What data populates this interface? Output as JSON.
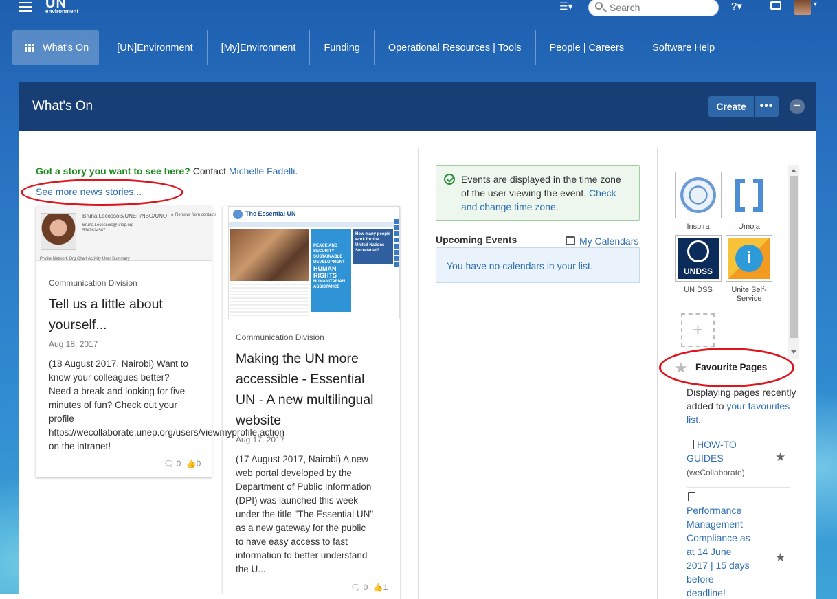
{
  "topbar": {
    "logo_big": "UN",
    "logo_small": "environment",
    "search_placeholder": "Search",
    "icons": [
      "menu-icon",
      "list-icon",
      "help-icon",
      "inbox-icon",
      "user-avatar"
    ]
  },
  "nav": {
    "items": [
      {
        "label": "What's On",
        "active": true
      },
      {
        "label": "[UN]Environment"
      },
      {
        "label": "[My]Environment"
      },
      {
        "label": "Funding"
      },
      {
        "label": "Operational Resources | Tools"
      },
      {
        "label": "People | Careers"
      },
      {
        "label": "Software Help"
      }
    ]
  },
  "panel": {
    "title": "What's On",
    "create_label": "Create",
    "more_label": "•••",
    "collapse_label": "−"
  },
  "news": {
    "story_prompt": "Got a story you want to see here?",
    "contact_text": " Contact ",
    "contact_name": "Michelle Fadelli",
    "contact_suffix": ".",
    "see_more": "See more news stories...",
    "cards": [
      {
        "thumb_name": "Bruna Lecossois/UNEP/NBO/UNO",
        "thumb_email": "Bruna.Lecossois@unep.org",
        "thumb_phone": "5347624587",
        "thumb_tabs": "Profile    Network    Org Chart    Activity    User Summary",
        "thumb_remove": "★ Remove from contacts",
        "division": "Communication Division",
        "title_line1": "Tell us a little about",
        "title_line2": "yourself...",
        "date": "Aug 18, 2017",
        "body": [
          "(18 August 2017, Nairobi) Want to",
          "know your colleagues better?",
          "Need a break and looking for five",
          "minutes of fun? Check out your",
          "profile",
          "https://wecollaborate.unep.org/users/viewmyprofile.action",
          "on the intranet!"
        ],
        "comments": "0",
        "likes": "0"
      },
      {
        "thumb_title": "The Essential UN",
        "thumb_banner": [
          "PEACE AND",
          "SECURITY",
          "SUSTAINABLE",
          "DEVELOPMENT",
          "HUMAN",
          "RIGHTS",
          "HUMANITARIAN",
          "ASSISTANCE"
        ],
        "thumb_side": [
          "How many people",
          "work for the",
          "United Nations",
          "Secretariat?"
        ],
        "division": "Communication Division",
        "title_lines": [
          "Making the UN more",
          "accessible - Essential",
          "UN - A new multilingual",
          "website"
        ],
        "date": "Aug 17, 2017",
        "body": [
          "(17 August 2017, Nairobi) A new",
          "web portal developed by the",
          "Department of Public Information",
          "(DPI) was launched this week",
          "under the title \"The Essential UN\"",
          "as a new gateway for the public",
          "to have easy access to fast",
          "information to better understand",
          "the U..."
        ],
        "comments": "0",
        "likes": "1"
      }
    ]
  },
  "events": {
    "note_line1": "Events are displayed in the time zone",
    "note_line2": "of the user viewing the event.",
    "note_link": "Check and change time zone",
    "note_suffix": ".",
    "upcoming_label": "Upcoming Events",
    "my_calendars": "My Calendars",
    "no_calendars": "You have no calendars in your list."
  },
  "apps": {
    "tiles": [
      {
        "label": "Inspira"
      },
      {
        "label": "Umoja"
      },
      {
        "label": "UN DSS"
      },
      {
        "label_line1": "Unite Self-",
        "label_line2": "Service"
      }
    ],
    "undss_text": "UNDSS",
    "selfsvc_text": "i",
    "add_label": "+"
  },
  "favourites": {
    "title": "Favourite Pages",
    "desc_prefix": "Displaying pages recently added to ",
    "desc_link": "your favourites list",
    "desc_suffix": ".",
    "items": [
      {
        "lines": [
          "HOW-TO",
          "GUIDES"
        ],
        "sub": "(weCollaborate)"
      },
      {
        "lines": [
          "Performance",
          "Management",
          "Compliance as",
          "at 14 June",
          "2017 | 15 days",
          "before",
          "deadline!"
        ]
      }
    ]
  },
  "colors": {
    "header": "#173f75",
    "link": "#2e6fb3",
    "highlight": "#e0141c",
    "story_green": "#1a8a1a"
  }
}
